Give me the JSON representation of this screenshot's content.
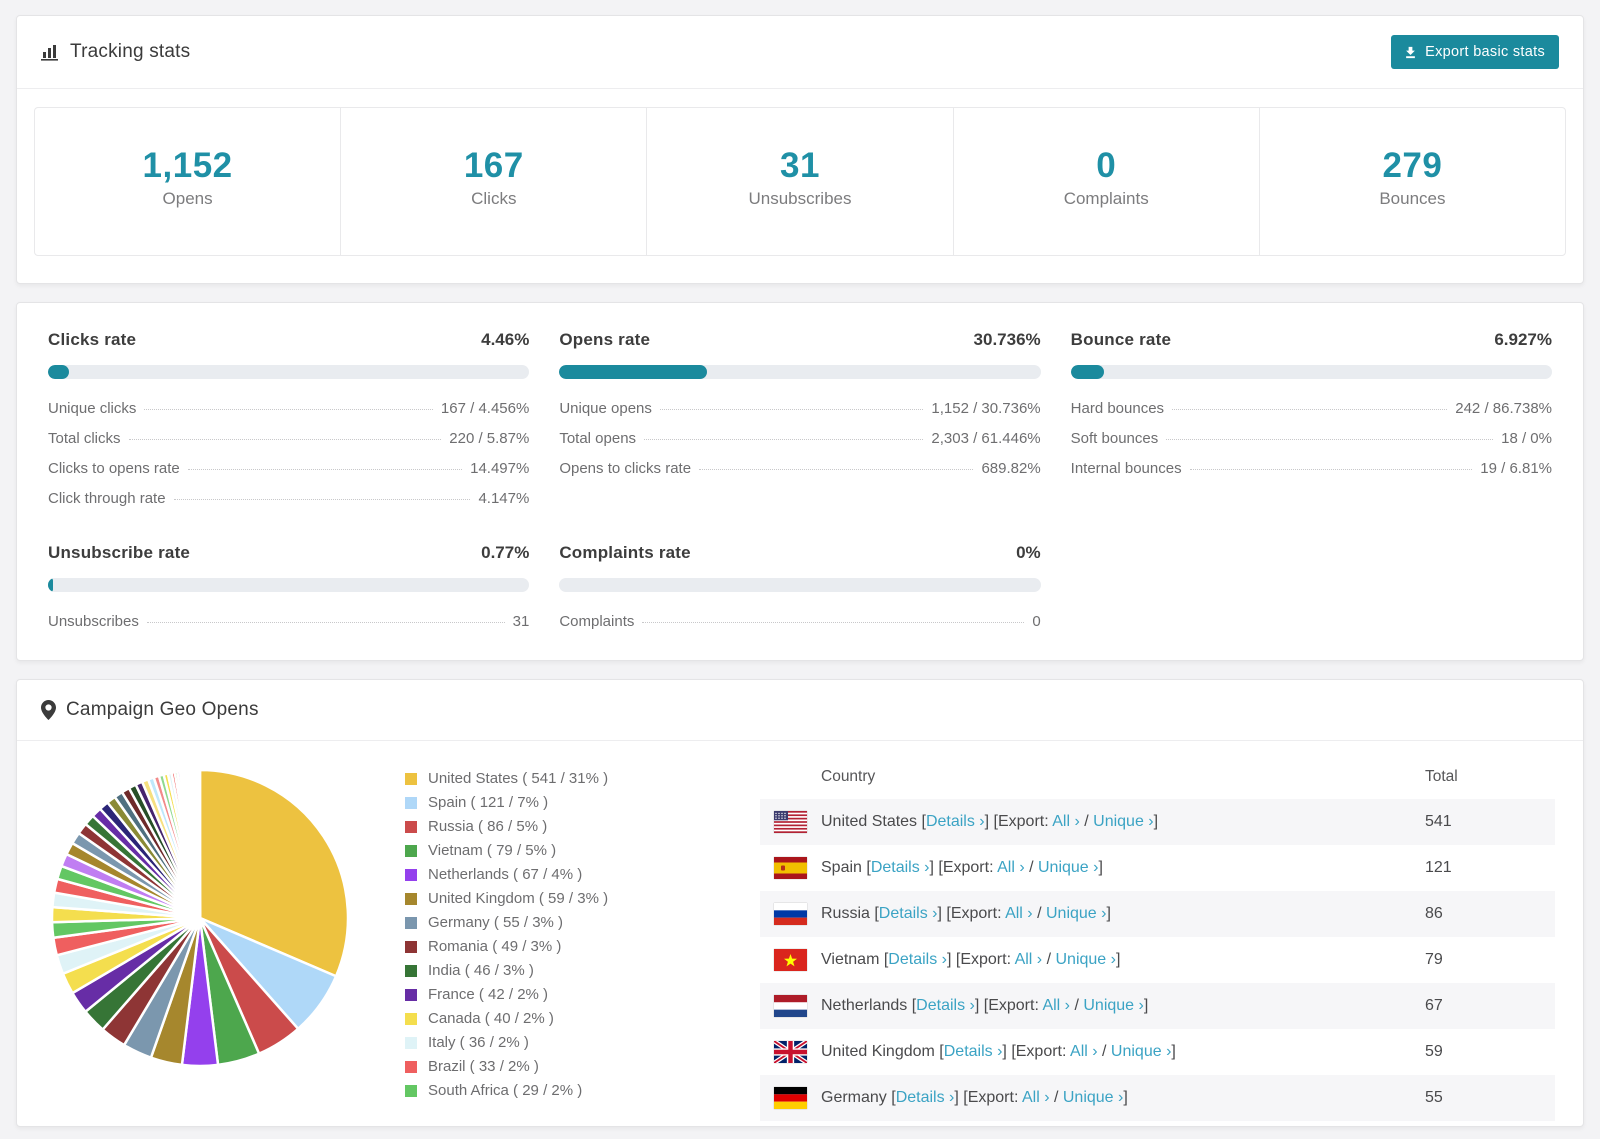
{
  "accent": "#1b8a9d",
  "tracking": {
    "title": "Tracking stats",
    "export_button": "Export basic stats",
    "stats": [
      {
        "value": "1,152",
        "label": "Opens"
      },
      {
        "value": "167",
        "label": "Clicks"
      },
      {
        "value": "31",
        "label": "Unsubscribes"
      },
      {
        "value": "0",
        "label": "Complaints"
      },
      {
        "value": "279",
        "label": "Bounces"
      }
    ]
  },
  "rates": [
    {
      "title": "Clicks rate",
      "value": "4.46%",
      "percent": 4.46,
      "rows": [
        {
          "label": "Unique clicks",
          "value": "167 / 4.456%"
        },
        {
          "label": "Total clicks",
          "value": "220 / 5.87%"
        },
        {
          "label": "Clicks to opens rate",
          "value": "14.497%"
        },
        {
          "label": "Click through rate",
          "value": "4.147%"
        }
      ]
    },
    {
      "title": "Opens rate",
      "value": "30.736%",
      "percent": 30.736,
      "rows": [
        {
          "label": "Unique opens",
          "value": "1,152 / 30.736%"
        },
        {
          "label": "Total opens",
          "value": "2,303 / 61.446%"
        },
        {
          "label": "Opens to clicks rate",
          "value": "689.82%"
        }
      ]
    },
    {
      "title": "Bounce rate",
      "value": "6.927%",
      "percent": 6.927,
      "rows": [
        {
          "label": "Hard bounces",
          "value": "242 / 86.738%"
        },
        {
          "label": "Soft bounces",
          "value": "18 / 0%"
        },
        {
          "label": "Internal bounces",
          "value": "19 / 6.81%"
        }
      ]
    },
    {
      "title": "Unsubscribe rate",
      "value": "0.77%",
      "percent": 0.77,
      "rows": [
        {
          "label": "Unsubscribes",
          "value": "31"
        }
      ]
    },
    {
      "title": "Complaints rate",
      "value": "0%",
      "percent": 0,
      "rows": [
        {
          "label": "Complaints",
          "value": "0"
        }
      ]
    }
  ],
  "geo": {
    "title": "Campaign Geo Opens",
    "table": {
      "headers": {
        "country": "Country",
        "total": "Total"
      },
      "link_text": {
        "bracket1": " [",
        "details": "Details ›",
        "bracket2": "] [Export: ",
        "all": "All ›",
        "slash": " / ",
        "unique": "Unique ›",
        "bracket3": "]"
      },
      "rows": [
        {
          "country": "United States",
          "flag": "us",
          "total": "541"
        },
        {
          "country": "Spain",
          "flag": "es",
          "total": "121"
        },
        {
          "country": "Russia",
          "flag": "ru",
          "total": "86"
        },
        {
          "country": "Vietnam",
          "flag": "vn",
          "total": "79"
        },
        {
          "country": "Netherlands",
          "flag": "nl",
          "total": "67"
        },
        {
          "country": "United Kingdom",
          "flag": "gb",
          "total": "59"
        },
        {
          "country": "Germany",
          "flag": "de",
          "total": "55",
          "partial": true
        }
      ]
    }
  },
  "chart_data": {
    "type": "pie",
    "title": "Campaign Geo Opens",
    "legend_position": "right",
    "start_angle_deg": 0,
    "slices": [
      {
        "label": "United States",
        "value": 541,
        "percent": 31,
        "color": "#edc240"
      },
      {
        "label": "Spain",
        "value": 121,
        "percent": 7,
        "color": "#afd8f8"
      },
      {
        "label": "Russia",
        "value": 86,
        "percent": 5,
        "color": "#cb4b4b"
      },
      {
        "label": "Vietnam",
        "value": 79,
        "percent": 5,
        "color": "#4da74d"
      },
      {
        "label": "Netherlands",
        "value": 67,
        "percent": 4,
        "color": "#9440ed"
      },
      {
        "label": "United Kingdom",
        "value": 59,
        "percent": 3,
        "color": "#a6872d"
      },
      {
        "label": "Germany",
        "value": 55,
        "percent": 3,
        "color": "#7b97ae"
      },
      {
        "label": "Romania",
        "value": 49,
        "percent": 3,
        "color": "#8e3535"
      },
      {
        "label": "India",
        "value": 46,
        "percent": 3,
        "color": "#367536"
      },
      {
        "label": "France",
        "value": 42,
        "percent": 2,
        "color": "#672da6"
      },
      {
        "label": "Canada",
        "value": 40,
        "percent": 2,
        "color": "#f4de4e"
      },
      {
        "label": "Italy",
        "value": 36,
        "percent": 2,
        "color": "#dff3f7"
      },
      {
        "label": "Brazil",
        "value": 33,
        "percent": 2,
        "color": "#ef5f5f"
      },
      {
        "label": "South Africa",
        "value": 29,
        "percent": 2,
        "color": "#63c763"
      }
    ],
    "unlabeled_slice_values": [
      28,
      27,
      26,
      25,
      24,
      23,
      22,
      21,
      20,
      19,
      18,
      17,
      16,
      15,
      14,
      13,
      12,
      11,
      10,
      9,
      8,
      7,
      6,
      5,
      5,
      4,
      4,
      3,
      3,
      3,
      2,
      2,
      2,
      2,
      2,
      1,
      1,
      1,
      1,
      1,
      1,
      1,
      1,
      1,
      1
    ],
    "unlabeled_slice_colors": [
      "#f4de4e",
      "#dff3f7",
      "#ef5f5f",
      "#63c763",
      "#c07ef2",
      "#a6872d",
      "#7b97ae",
      "#8e3535",
      "#367536",
      "#672da6",
      "#2b2577",
      "#8a8a35",
      "#4f7080",
      "#6e2a2a",
      "#274f27",
      "#46246e",
      "#f6e07f",
      "#bfe8fb",
      "#f28a8a",
      "#8fd98f"
    ]
  }
}
